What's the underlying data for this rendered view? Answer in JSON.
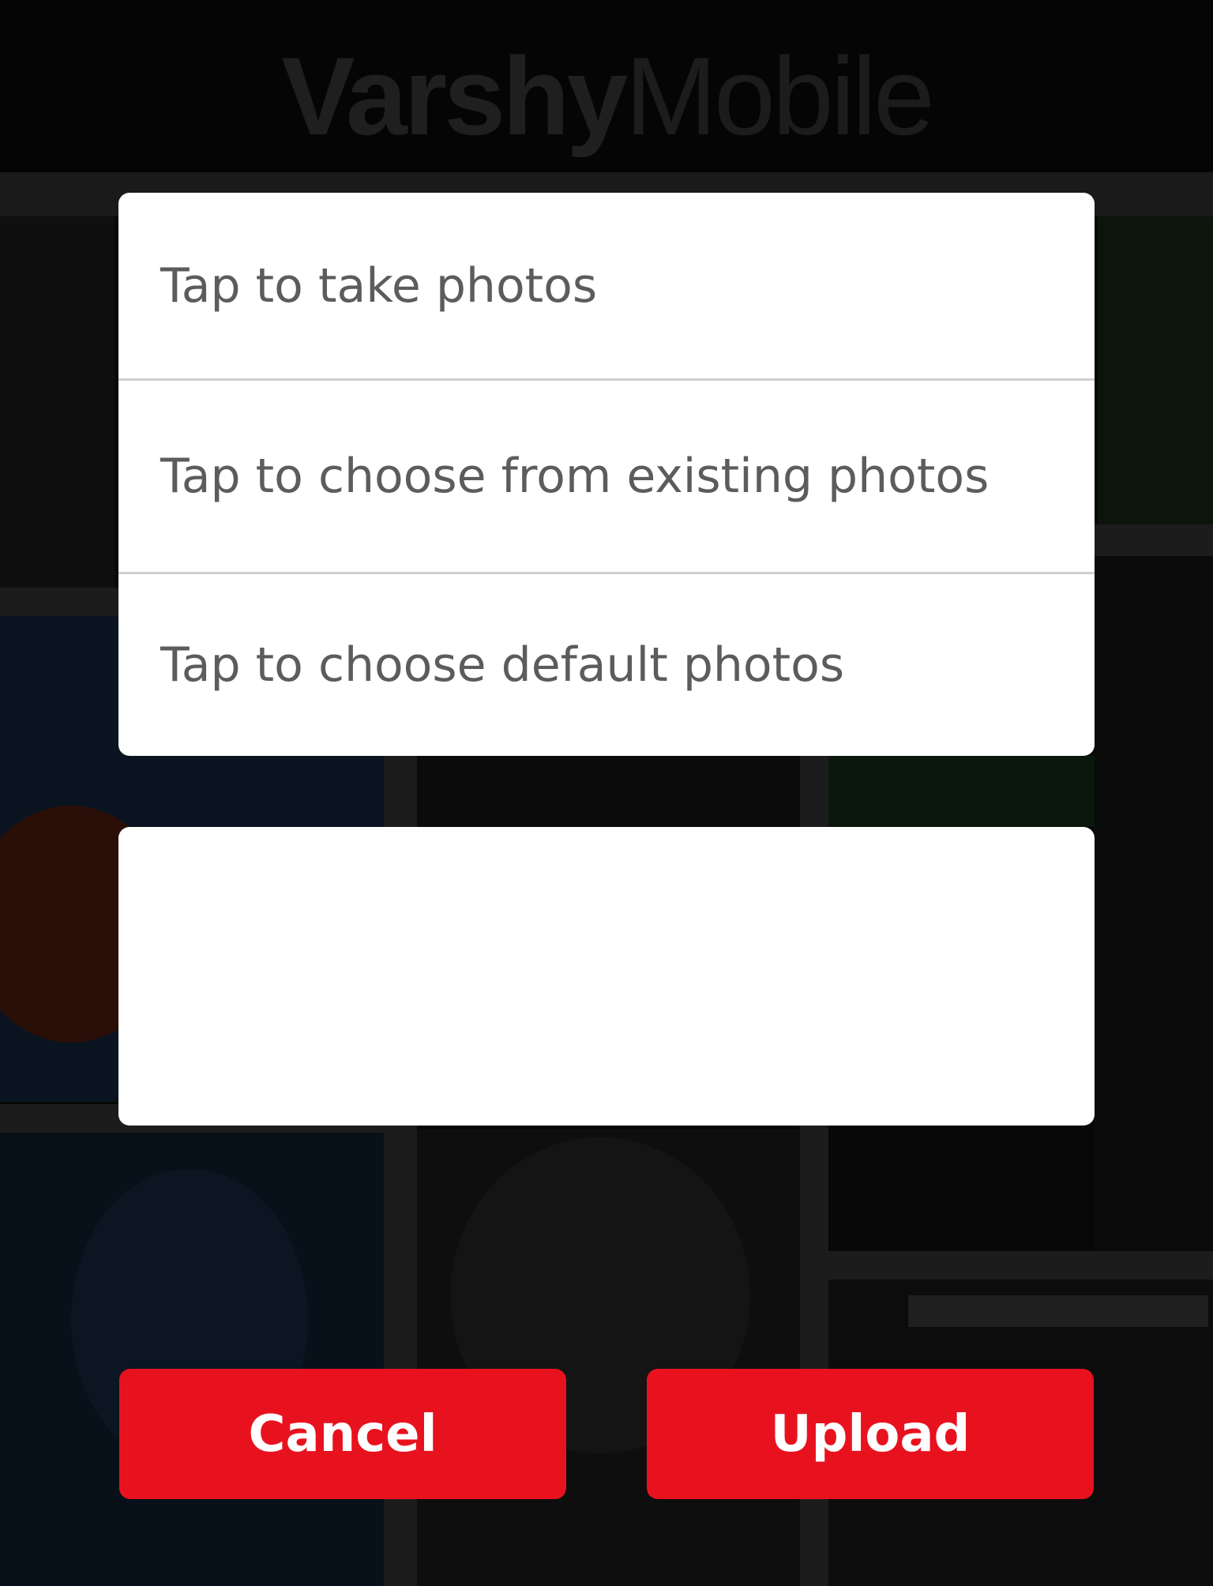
{
  "background": {
    "logo": {
      "bold_part": "Varshy",
      "thin_part": "Mobile"
    }
  },
  "photo_source_menu": {
    "options": [
      {
        "label": "Tap to take photos"
      },
      {
        "label": "Tap to choose from existing photos"
      },
      {
        "label": "Tap to choose default photos"
      }
    ]
  },
  "actions": {
    "cancel_label": "Cancel",
    "upload_label": "Upload"
  },
  "colors": {
    "accent": "#e8121f",
    "overlay": "#080808",
    "option_text": "#5c5c5c"
  }
}
